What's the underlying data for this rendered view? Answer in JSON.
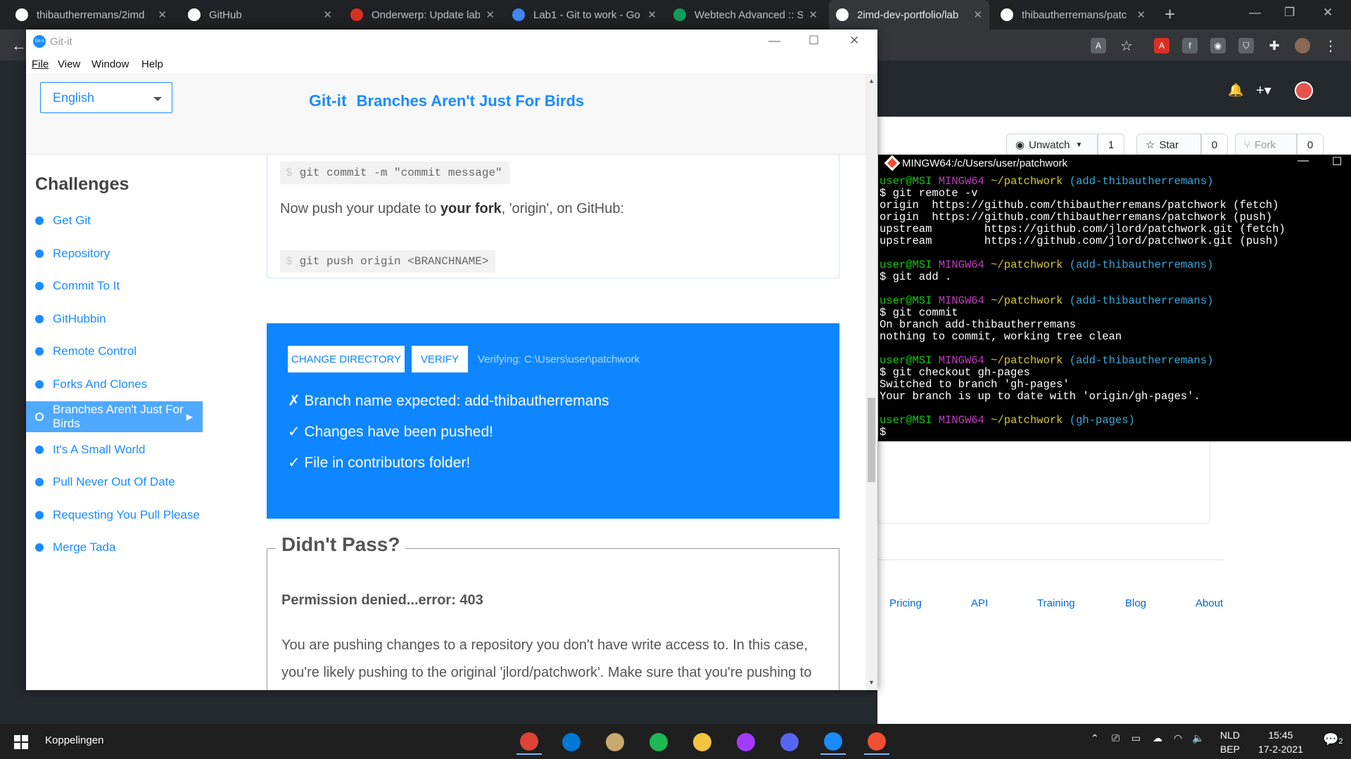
{
  "browser": {
    "tabs": [
      {
        "label": "thibautherremans/2imd",
        "icon": "github-icon",
        "active": false
      },
      {
        "label": "GitHub",
        "icon": "github-icon",
        "active": false
      },
      {
        "label": "Onderwerp: Update lab",
        "icon": "forum-icon",
        "active": false
      },
      {
        "label": "Lab1 - Git to work - Go",
        "icon": "google-docs-icon",
        "active": false
      },
      {
        "label": "Webtech Advanced :: S",
        "icon": "google-sheets-icon",
        "active": false
      },
      {
        "label": "2imd-dev-portfolio/lab",
        "icon": "github-icon",
        "active": true
      },
      {
        "label": "thibautherremans/patc",
        "icon": "github-icon",
        "active": false
      }
    ],
    "new_tab_symbol": "+",
    "close_symbol": "✕"
  },
  "github_page": {
    "watch_label": "Unwatch",
    "watch_count": "1",
    "star_label": "Star",
    "star_count": "0",
    "fork_label": "Fork",
    "fork_count": "0",
    "footer_links": [
      "Pricing",
      "API",
      "Training",
      "Blog",
      "About"
    ]
  },
  "gitit": {
    "window_title": "Git-it",
    "menu": [
      "File",
      "View",
      "Window",
      "Help"
    ],
    "language": "English",
    "brand": "Git-it",
    "challenge_title": "Branches Aren't Just For Birds",
    "sidebar_title": "Challenges",
    "challenges": [
      {
        "label": "Get Git",
        "active": false
      },
      {
        "label": "Repository",
        "active": false
      },
      {
        "label": "Commit To It",
        "active": false
      },
      {
        "label": "GitHubbin",
        "active": false
      },
      {
        "label": "Remote Control",
        "active": false
      },
      {
        "label": "Forks And Clones",
        "active": false
      },
      {
        "label": "Branches Aren't Just For Birds",
        "active": true
      },
      {
        "label": "It's A Small World",
        "active": false
      },
      {
        "label": "Pull Never Out Of Date",
        "active": false
      },
      {
        "label": "Requesting You Pull Please",
        "active": false
      },
      {
        "label": "Merge Tada",
        "active": false
      }
    ],
    "cmd_commit": "git commit -m \"commit message\"",
    "push_text_before": "Now push your update to ",
    "push_text_bold": "your fork",
    "push_text_after": ", 'origin', on GitHub:",
    "cmd_push": "git push origin <BRANCHNAME>",
    "prompt_symbol": "$",
    "change_dir_label": "CHANGE DIRECTORY",
    "verify_label": "VERIFY",
    "verifying_text": "Verifying: C:\\Users\\user\\patchwork",
    "results": [
      "✗ Branch name expected: add-thibautherremans",
      "✓ Changes have been pushed!",
      "✓ File in contributors folder!"
    ],
    "didnt_pass_title": "Didn't Pass?",
    "error_title": "Permission denied...error: 403",
    "error_text": "You are pushing changes to a repository you don't have write access to. In this case, you're likely pushing to the original 'jlord/patchwork'. Make sure that you're pushing to 'origin' and that it points to your fork's address on GitHub. To check and"
  },
  "terminal": {
    "title": "MINGW64:/c/Users/user/patchwork",
    "lines": [
      {
        "type": "prompt",
        "user": "user@MSI",
        "host": "MINGW64",
        "path": "~/patchwork",
        "branch": "(add-thibautherremans)"
      },
      {
        "type": "text",
        "text": "$ git remote -v"
      },
      {
        "type": "text",
        "text": "origin  https://github.com/thibautherremans/patchwork (fetch)"
      },
      {
        "type": "text",
        "text": "origin  https://github.com/thibautherremans/patchwork (push)"
      },
      {
        "type": "text",
        "text": "upstream        https://github.com/jlord/patchwork.git (fetch)"
      },
      {
        "type": "text",
        "text": "upstream        https://github.com/jlord/patchwork.git (push)"
      },
      {
        "type": "text",
        "text": ""
      },
      {
        "type": "prompt",
        "user": "user@MSI",
        "host": "MINGW64",
        "path": "~/patchwork",
        "branch": "(add-thibautherremans)"
      },
      {
        "type": "text",
        "text": "$ git add ."
      },
      {
        "type": "text",
        "text": ""
      },
      {
        "type": "prompt",
        "user": "user@MSI",
        "host": "MINGW64",
        "path": "~/patchwork",
        "branch": "(add-thibautherremans)"
      },
      {
        "type": "text",
        "text": "$ git commit"
      },
      {
        "type": "text",
        "text": "On branch add-thibautherremans"
      },
      {
        "type": "text",
        "text": "nothing to commit, working tree clean"
      },
      {
        "type": "text",
        "text": ""
      },
      {
        "type": "prompt",
        "user": "user@MSI",
        "host": "MINGW64",
        "path": "~/patchwork",
        "branch": "(add-thibautherremans)"
      },
      {
        "type": "text",
        "text": "$ git checkout gh-pages"
      },
      {
        "type": "text",
        "text": "Switched to branch 'gh-pages'"
      },
      {
        "type": "text",
        "text": "Your branch is up to date with 'origin/gh-pages'."
      },
      {
        "type": "text",
        "text": ""
      },
      {
        "type": "prompt",
        "user": "user@MSI",
        "host": "MINGW64",
        "path": "~/patchwork",
        "branch": "(gh-pages)"
      },
      {
        "type": "text",
        "text": "$"
      }
    ]
  },
  "taskbar": {
    "search_label": "Koppelingen",
    "apps": [
      {
        "name": "chrome-icon",
        "color": "#db4437",
        "running": true
      },
      {
        "name": "mail-icon",
        "color": "#0078d4",
        "running": false
      },
      {
        "name": "league-of-legends-icon",
        "color": "#c8aa6e",
        "running": false
      },
      {
        "name": "spotify-icon",
        "color": "#1db954",
        "running": false
      },
      {
        "name": "file-explorer-icon",
        "color": "#f4c542",
        "running": false
      },
      {
        "name": "messenger-icon",
        "color": "#a33bff",
        "running": false
      },
      {
        "name": "discord-icon",
        "color": "#5865f2",
        "running": false
      },
      {
        "name": "gitit-icon",
        "color": "#1a8cff",
        "running": true
      },
      {
        "name": "git-bash-icon",
        "color": "#f14e32",
        "running": true
      }
    ],
    "language_top": "NLD",
    "language_bottom": "BEP",
    "time": "15:45",
    "date": "17-2-2021",
    "notification_count": "2"
  }
}
